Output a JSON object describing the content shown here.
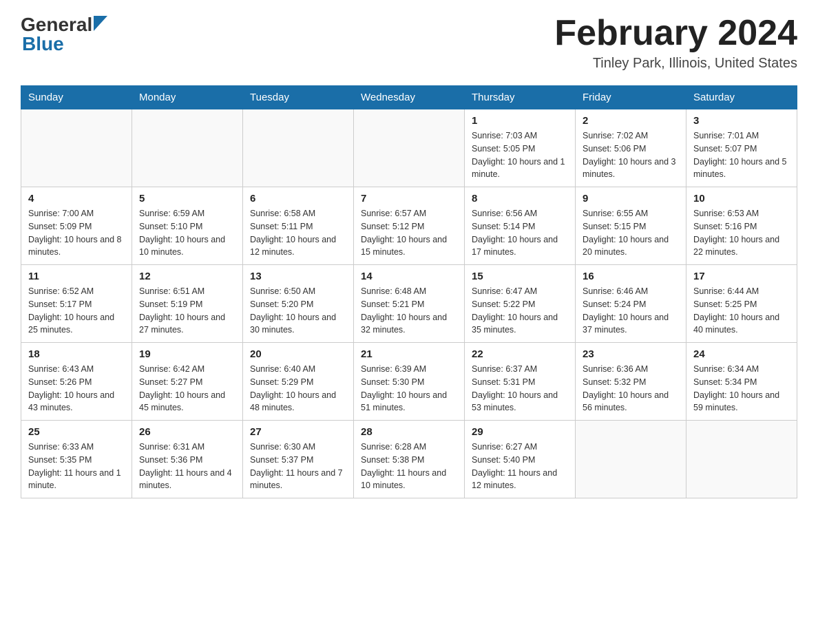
{
  "header": {
    "logo_general": "General",
    "logo_blue": "Blue",
    "month_year": "February 2024",
    "location": "Tinley Park, Illinois, United States"
  },
  "days_of_week": [
    "Sunday",
    "Monday",
    "Tuesday",
    "Wednesday",
    "Thursday",
    "Friday",
    "Saturday"
  ],
  "weeks": [
    [
      {
        "day": "",
        "info": ""
      },
      {
        "day": "",
        "info": ""
      },
      {
        "day": "",
        "info": ""
      },
      {
        "day": "",
        "info": ""
      },
      {
        "day": "1",
        "info": "Sunrise: 7:03 AM\nSunset: 5:05 PM\nDaylight: 10 hours and 1 minute."
      },
      {
        "day": "2",
        "info": "Sunrise: 7:02 AM\nSunset: 5:06 PM\nDaylight: 10 hours and 3 minutes."
      },
      {
        "day": "3",
        "info": "Sunrise: 7:01 AM\nSunset: 5:07 PM\nDaylight: 10 hours and 5 minutes."
      }
    ],
    [
      {
        "day": "4",
        "info": "Sunrise: 7:00 AM\nSunset: 5:09 PM\nDaylight: 10 hours and 8 minutes."
      },
      {
        "day": "5",
        "info": "Sunrise: 6:59 AM\nSunset: 5:10 PM\nDaylight: 10 hours and 10 minutes."
      },
      {
        "day": "6",
        "info": "Sunrise: 6:58 AM\nSunset: 5:11 PM\nDaylight: 10 hours and 12 minutes."
      },
      {
        "day": "7",
        "info": "Sunrise: 6:57 AM\nSunset: 5:12 PM\nDaylight: 10 hours and 15 minutes."
      },
      {
        "day": "8",
        "info": "Sunrise: 6:56 AM\nSunset: 5:14 PM\nDaylight: 10 hours and 17 minutes."
      },
      {
        "day": "9",
        "info": "Sunrise: 6:55 AM\nSunset: 5:15 PM\nDaylight: 10 hours and 20 minutes."
      },
      {
        "day": "10",
        "info": "Sunrise: 6:53 AM\nSunset: 5:16 PM\nDaylight: 10 hours and 22 minutes."
      }
    ],
    [
      {
        "day": "11",
        "info": "Sunrise: 6:52 AM\nSunset: 5:17 PM\nDaylight: 10 hours and 25 minutes."
      },
      {
        "day": "12",
        "info": "Sunrise: 6:51 AM\nSunset: 5:19 PM\nDaylight: 10 hours and 27 minutes."
      },
      {
        "day": "13",
        "info": "Sunrise: 6:50 AM\nSunset: 5:20 PM\nDaylight: 10 hours and 30 minutes."
      },
      {
        "day": "14",
        "info": "Sunrise: 6:48 AM\nSunset: 5:21 PM\nDaylight: 10 hours and 32 minutes."
      },
      {
        "day": "15",
        "info": "Sunrise: 6:47 AM\nSunset: 5:22 PM\nDaylight: 10 hours and 35 minutes."
      },
      {
        "day": "16",
        "info": "Sunrise: 6:46 AM\nSunset: 5:24 PM\nDaylight: 10 hours and 37 minutes."
      },
      {
        "day": "17",
        "info": "Sunrise: 6:44 AM\nSunset: 5:25 PM\nDaylight: 10 hours and 40 minutes."
      }
    ],
    [
      {
        "day": "18",
        "info": "Sunrise: 6:43 AM\nSunset: 5:26 PM\nDaylight: 10 hours and 43 minutes."
      },
      {
        "day": "19",
        "info": "Sunrise: 6:42 AM\nSunset: 5:27 PM\nDaylight: 10 hours and 45 minutes."
      },
      {
        "day": "20",
        "info": "Sunrise: 6:40 AM\nSunset: 5:29 PM\nDaylight: 10 hours and 48 minutes."
      },
      {
        "day": "21",
        "info": "Sunrise: 6:39 AM\nSunset: 5:30 PM\nDaylight: 10 hours and 51 minutes."
      },
      {
        "day": "22",
        "info": "Sunrise: 6:37 AM\nSunset: 5:31 PM\nDaylight: 10 hours and 53 minutes."
      },
      {
        "day": "23",
        "info": "Sunrise: 6:36 AM\nSunset: 5:32 PM\nDaylight: 10 hours and 56 minutes."
      },
      {
        "day": "24",
        "info": "Sunrise: 6:34 AM\nSunset: 5:34 PM\nDaylight: 10 hours and 59 minutes."
      }
    ],
    [
      {
        "day": "25",
        "info": "Sunrise: 6:33 AM\nSunset: 5:35 PM\nDaylight: 11 hours and 1 minute."
      },
      {
        "day": "26",
        "info": "Sunrise: 6:31 AM\nSunset: 5:36 PM\nDaylight: 11 hours and 4 minutes."
      },
      {
        "day": "27",
        "info": "Sunrise: 6:30 AM\nSunset: 5:37 PM\nDaylight: 11 hours and 7 minutes."
      },
      {
        "day": "28",
        "info": "Sunrise: 6:28 AM\nSunset: 5:38 PM\nDaylight: 11 hours and 10 minutes."
      },
      {
        "day": "29",
        "info": "Sunrise: 6:27 AM\nSunset: 5:40 PM\nDaylight: 11 hours and 12 minutes."
      },
      {
        "day": "",
        "info": ""
      },
      {
        "day": "",
        "info": ""
      }
    ]
  ]
}
